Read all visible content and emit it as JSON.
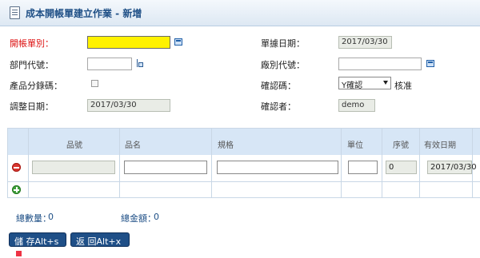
{
  "header": {
    "title": "成本開帳單建立作業 - 新增"
  },
  "form": {
    "open_doc_label": "開帳單別：",
    "doc_date_label": "單據日期：",
    "doc_date_value": "2017/03/30",
    "dept_label": "部門代號：",
    "factory_label": "廠別代號：",
    "product_code_label": "產品分錄碼：",
    "confirm_code_label": "確認碼：",
    "confirm_code_value": "Y確認",
    "approve_label": "核准",
    "adjust_date_label": "調整日期：",
    "adjust_date_value": "2017/03/30",
    "confirmer_label": "確認者：",
    "confirmer_value": "demo"
  },
  "grid": {
    "columns": [
      "品號",
      "品名",
      "規格",
      "單位",
      "序號",
      "有效日期"
    ],
    "row": {
      "seq_value": "0",
      "expiry_value": "2017/03/30"
    }
  },
  "summary": {
    "qty_label": "總數量：",
    "qty_value": "0",
    "amount_label": "總金額：",
    "amount_value": "0"
  },
  "buttons": {
    "save": "儲 存Alt+s",
    "back": "返 回Alt+x"
  }
}
